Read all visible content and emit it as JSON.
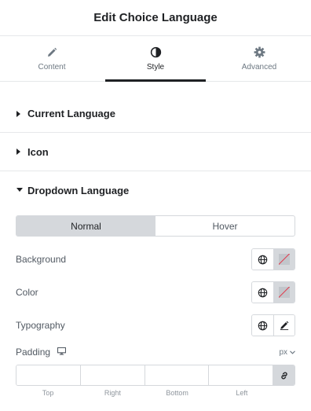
{
  "header": {
    "title": "Edit Choice Language"
  },
  "tabs": [
    {
      "label": "Content",
      "icon": "pencil-icon",
      "active": false
    },
    {
      "label": "Style",
      "icon": "contrast-icon",
      "active": true
    },
    {
      "label": "Advanced",
      "icon": "gear-icon",
      "active": false
    }
  ],
  "sections": [
    {
      "label": "Current Language",
      "expanded": false
    },
    {
      "label": "Icon",
      "expanded": false
    },
    {
      "label": "Dropdown Language",
      "expanded": true
    }
  ],
  "state_toggle": {
    "normal": "Normal",
    "hover": "Hover",
    "selected": "Normal"
  },
  "controls": {
    "background": {
      "label": "Background"
    },
    "color": {
      "label": "Color"
    },
    "typography": {
      "label": "Typography"
    }
  },
  "padding": {
    "label": "Padding",
    "unit": "px",
    "fields": {
      "top": "Top",
      "right": "Right",
      "bottom": "Bottom",
      "left": "Left"
    },
    "values": {
      "top": "",
      "right": "",
      "bottom": "",
      "left": ""
    }
  },
  "colors": {
    "accent": "#1f2124",
    "border": "#d5d8dc",
    "active_bg": "#d5d8dc",
    "no_color_line": "#e2394b"
  }
}
